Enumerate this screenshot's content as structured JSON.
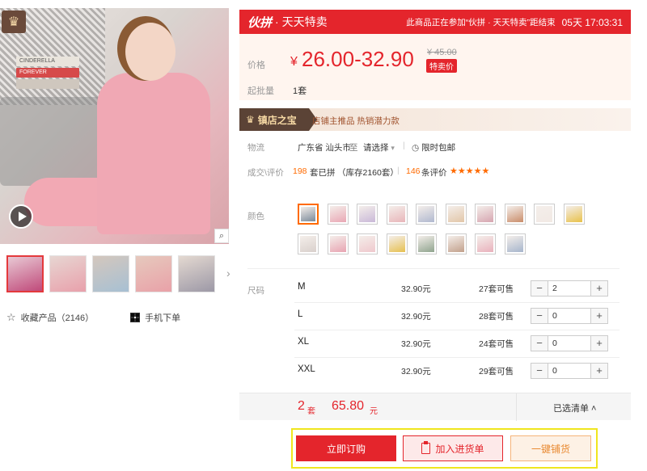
{
  "gallery": {
    "book_spines": [
      "CINDERELLA",
      "FOREVER"
    ],
    "zoom_icon": "magnifier-icon",
    "play_icon": "play-icon",
    "thumbnails": [
      {
        "active": true
      },
      {
        "active": false
      },
      {
        "active": false
      },
      {
        "active": false
      },
      {
        "active": false
      }
    ],
    "next_arrow": "›"
  },
  "actions_left": {
    "favorite_label": "收藏产品（2146）",
    "mobile_order_label": "手机下单"
  },
  "promo": {
    "logo": "伙拼",
    "name": "· 天天特卖",
    "note": "此商品正在参加“伙拼 · 天天特卖”距结束",
    "countdown": "05天 17:03:31",
    "color": "#e4252c"
  },
  "price": {
    "label": "价格",
    "currency": "¥",
    "range": "26.00-32.90",
    "original": "¥ 45.00",
    "tag": "特卖价",
    "min_batch_label": "起批量",
    "min_batch_value": "1套"
  },
  "shop": {
    "badge": "镇店之宝",
    "tags": "店铺主推品    热销潜力款"
  },
  "logistics": {
    "label": "物流",
    "origin": "广东省 汕头市",
    "to": "至",
    "dest": "请选择",
    "shipping_icon": "clock-icon",
    "shipping": "限时包邮"
  },
  "stats": {
    "label": "成交\\评价",
    "sold_count": "198",
    "sold_text": "套已拼",
    "stock_text": "（库存2160套）",
    "review_count": "146",
    "review_text": "条评价",
    "rating": 4.5,
    "stars": "★★★★★"
  },
  "colors": {
    "label": "颜色",
    "swatches": [
      {
        "color": "#7a8a9a",
        "selected": true
      },
      {
        "color": "#e9a7b4",
        "selected": false
      },
      {
        "color": "#c9b8d8",
        "selected": false
      },
      {
        "color": "#e8b5b9",
        "selected": false
      },
      {
        "color": "#b0b8cf",
        "selected": false
      },
      {
        "color": "#e2c6a8",
        "selected": false
      },
      {
        "color": "#d6a5b0",
        "selected": false
      },
      {
        "color": "#c98d6a",
        "selected": false
      },
      {
        "color": "#f1e9e4",
        "selected": false
      },
      {
        "color": "#e8c14a",
        "selected": false
      },
      {
        "color": "#d9d0cc",
        "selected": false
      },
      {
        "color": "#e8a4b2",
        "selected": false
      },
      {
        "color": "#efc8cd",
        "selected": false
      },
      {
        "color": "#e6c050",
        "selected": false
      },
      {
        "color": "#8fa48e",
        "selected": false
      },
      {
        "color": "#c2a08b",
        "selected": false
      },
      {
        "color": "#e9b1bc",
        "selected": false
      },
      {
        "color": "#a6b5cc",
        "selected": false
      }
    ]
  },
  "sizes": {
    "label": "尺码",
    "rows": [
      {
        "name": "M",
        "price": "32.90元",
        "stock": "27套可售",
        "qty": "2"
      },
      {
        "name": "L",
        "price": "32.90元",
        "stock": "28套可售",
        "qty": "0"
      },
      {
        "name": "XL",
        "price": "32.90元",
        "stock": "24套可售",
        "qty": "0"
      },
      {
        "name": "XXL",
        "price": "32.90元",
        "stock": "29套可售",
        "qty": "0"
      }
    ],
    "minus": "−",
    "plus": "+"
  },
  "summary": {
    "count": "2",
    "count_unit": "套",
    "amount": "65.80",
    "amount_unit": "元",
    "list_label": "已选清单 ˄"
  },
  "buttons": {
    "buy_now": "立即订购",
    "add_to_list": "加入进货单",
    "one_click": "一键铺货"
  }
}
